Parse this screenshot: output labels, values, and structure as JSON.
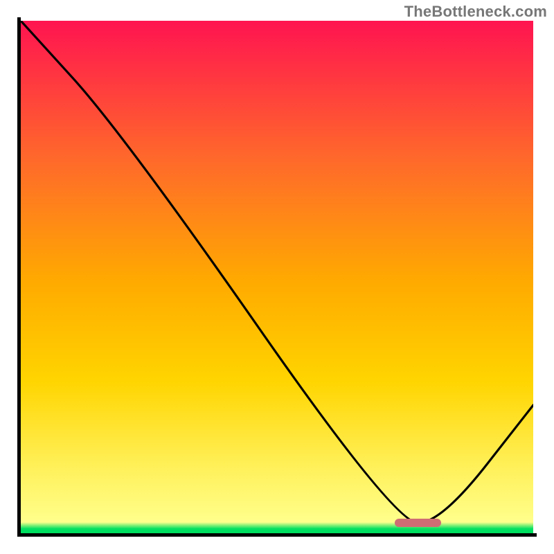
{
  "watermark": "TheBottleneck.com",
  "colors": {
    "axis": "#000000",
    "curve": "#000000",
    "marker": "#ce6d74",
    "watermark_text": "#777777"
  },
  "chart_data": {
    "type": "line",
    "title": "",
    "xlabel": "",
    "ylabel": "",
    "xlim": [
      0,
      100
    ],
    "ylim": [
      0,
      100
    ],
    "x": [
      0,
      20,
      73,
      82,
      100
    ],
    "values": [
      100,
      78,
      2,
      2,
      25
    ],
    "minimum_band": {
      "x_start": 73,
      "x_end": 82,
      "y": 2
    },
    "gradient": {
      "top_color": "#ff1450",
      "mid_color": "#ffd500",
      "lower_color": "#ffff8c",
      "bottom_color": "#00e060",
      "green_band_height_fraction": 0.022
    },
    "annotations": [
      "TheBottleneck.com"
    ]
  }
}
